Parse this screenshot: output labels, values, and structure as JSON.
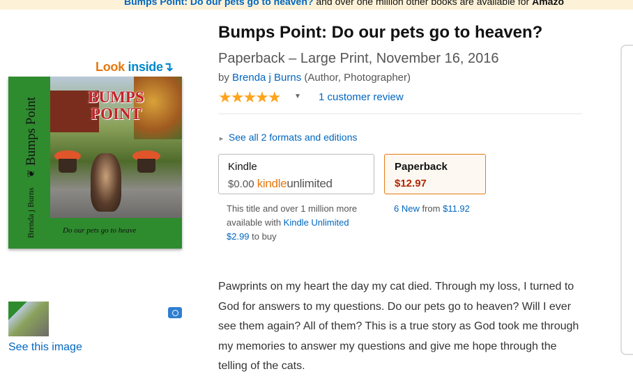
{
  "banner": {
    "title_link": "Bumps Point: Do our pets go to heaven?",
    "text": " and over one million other books are available for ",
    "amazon": "Amazo"
  },
  "image_block": {
    "look_inside_look": "Look",
    "look_inside_inside": "inside",
    "look_inside_arrow": "↴",
    "cover": {
      "title_line1": "BUMPS",
      "title_line2": "POINT",
      "spine_title": "Bumps Point",
      "spine_author": "Brenda j Burns",
      "spine_ornament": "❦",
      "tagline": "Do our pets go to heave"
    },
    "see_image_label": "See this image"
  },
  "product": {
    "title": "Bumps Point: Do our pets go to heaven?",
    "format_line": "Paperback – Large Print, November 16, 2016",
    "by_prefix": "by ",
    "author": "Brenda j Burns",
    "author_role": " (Author, Photographer)",
    "rating": 5,
    "rating_max": 5,
    "stars_text": "★★★★★",
    "caret": "▼",
    "review_link": "1 customer review",
    "see_all_formats": "See all 2 formats and editions",
    "see_all_arrow": "►"
  },
  "formats": {
    "kindle": {
      "label": "Kindle",
      "price": "$0.00",
      "ku_kindle": "kindle",
      "ku_unlimited": "unlimited",
      "note_text": "This title and over 1 million more available with ",
      "note_link": "Kindle Unlimited",
      "buy_price": "$2.99",
      "buy_suffix": " to buy"
    },
    "paperback": {
      "label": "Paperback",
      "price": "$12.97",
      "new_link": "6 New",
      "from_text": " from ",
      "from_price": "$11.92"
    }
  },
  "description": "Pawprints on my heart the day my cat died. Through my loss, I turned to God for answers to my questions. Do our pets go to heaven? Will I ever see them again? All of them? This is a true story as God took me through my memories to answer my questions and give me hope through the telling of the cats."
}
